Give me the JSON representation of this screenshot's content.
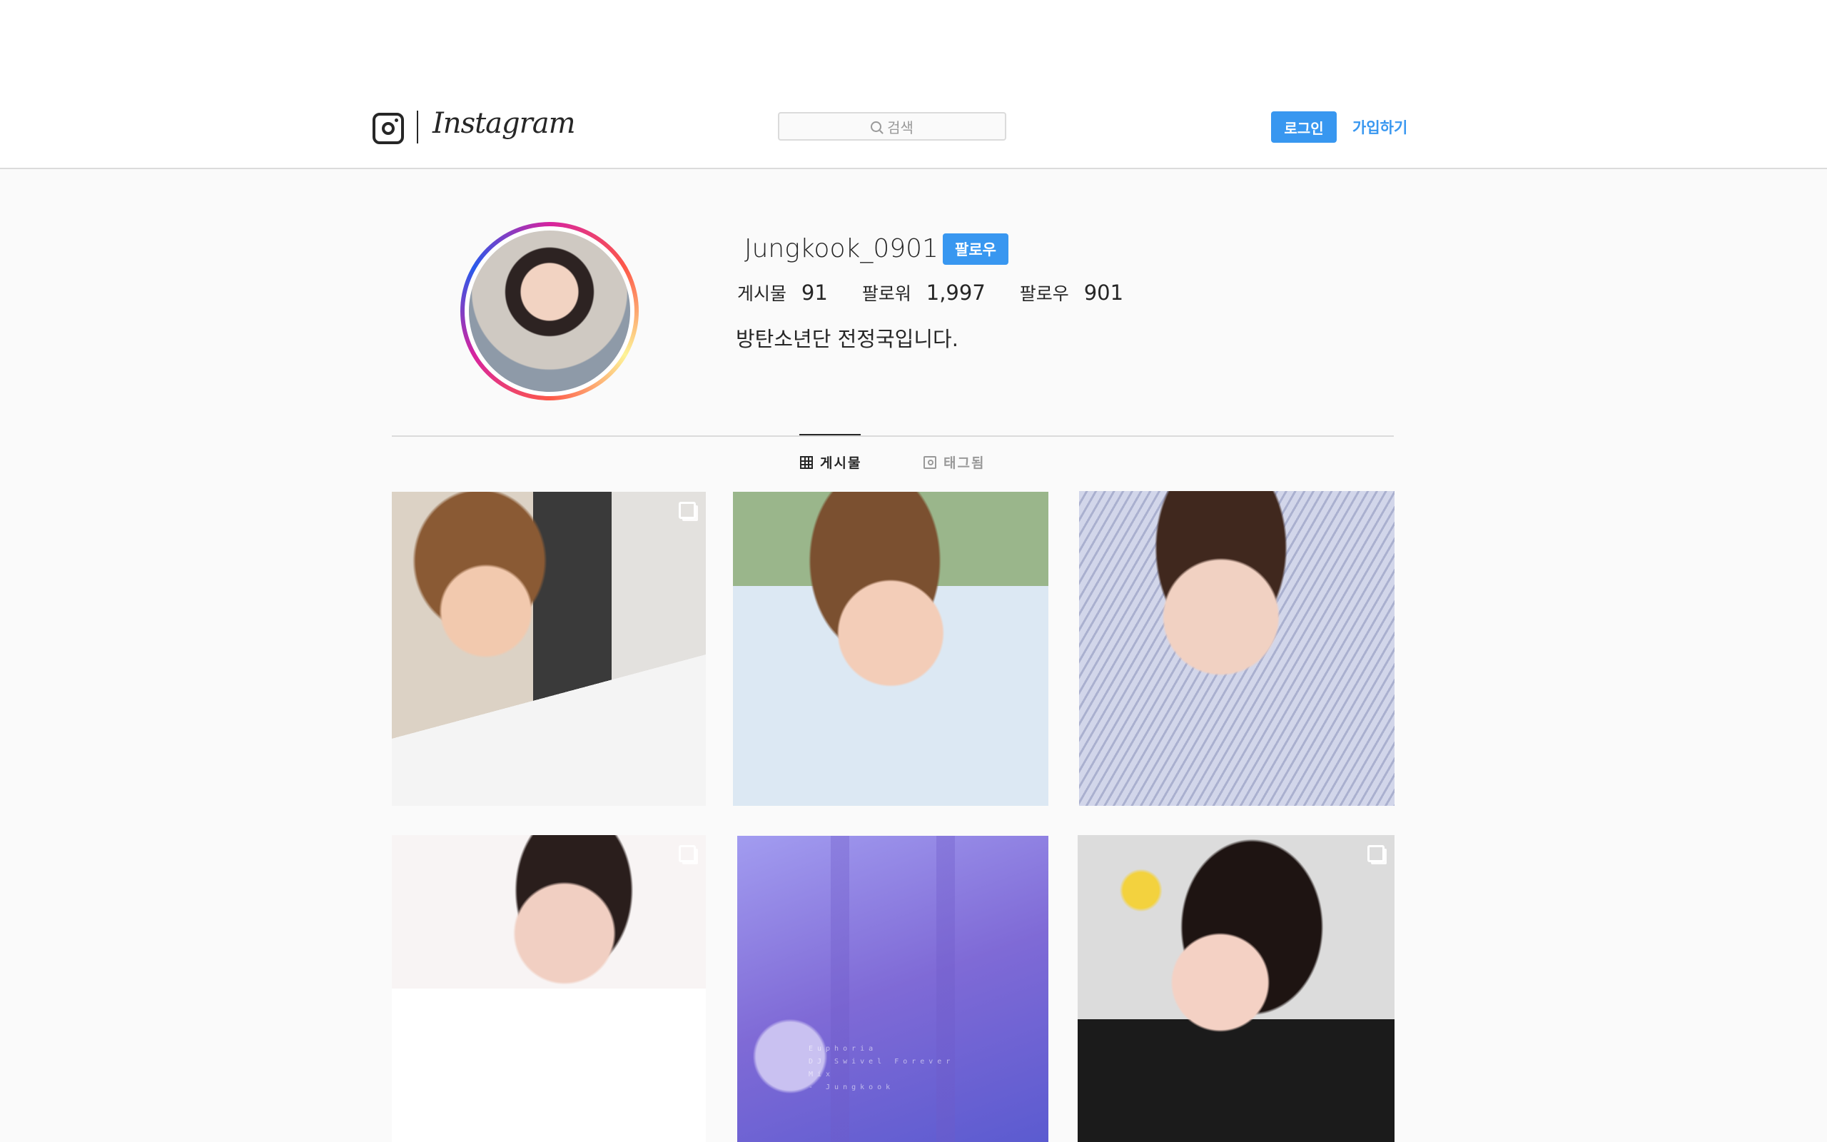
{
  "header": {
    "logo_text": "Instagram",
    "search_placeholder": "검색",
    "login_label": "로그인",
    "signup_label": "가입하기"
  },
  "profile": {
    "username": "Jungkook_0901",
    "follow_label": "팔로우",
    "stats": [
      {
        "label": "게시물",
        "value": "91"
      },
      {
        "label": "팔로워",
        "value": "1,997"
      },
      {
        "label": "팔로우",
        "value": "901"
      }
    ],
    "bio": "방탄소년단 전정국입니다."
  },
  "tabs": {
    "posts_label": "게시물",
    "tagged_label": "태그됨"
  },
  "posts": {
    "album_text": "Euphoria\nDJ Swivel Forever\nMix\n- Jungkook"
  },
  "colors": {
    "accent": "#3897f0",
    "text": "#262626",
    "muted": "#999999",
    "border": "#dbdbdb",
    "background": "#fafafa"
  },
  "icons": [
    "instagram-logo-icon",
    "search-icon",
    "grid-icon",
    "tag-icon",
    "multi-post-icon"
  ]
}
